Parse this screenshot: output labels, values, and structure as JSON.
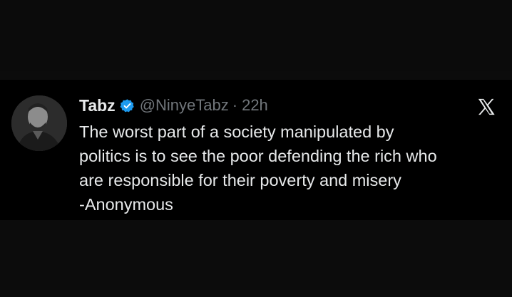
{
  "tweet": {
    "display_name": "Tabz",
    "handle": "@NinyeTabz",
    "separator": "·",
    "time": "22h",
    "lines": [
      "The worst part of a society manipulated by",
      "politics is to see the poor defending the rich who",
      "are responsible for their poverty and misery",
      "-Anonymous"
    ]
  },
  "icons": {
    "verified": "verified-badge-icon",
    "platform": "x-logo-icon"
  },
  "colors": {
    "background": "#000000",
    "text": "#e7e9ea",
    "muted": "#71767b",
    "verified": "#1d9bf0"
  }
}
